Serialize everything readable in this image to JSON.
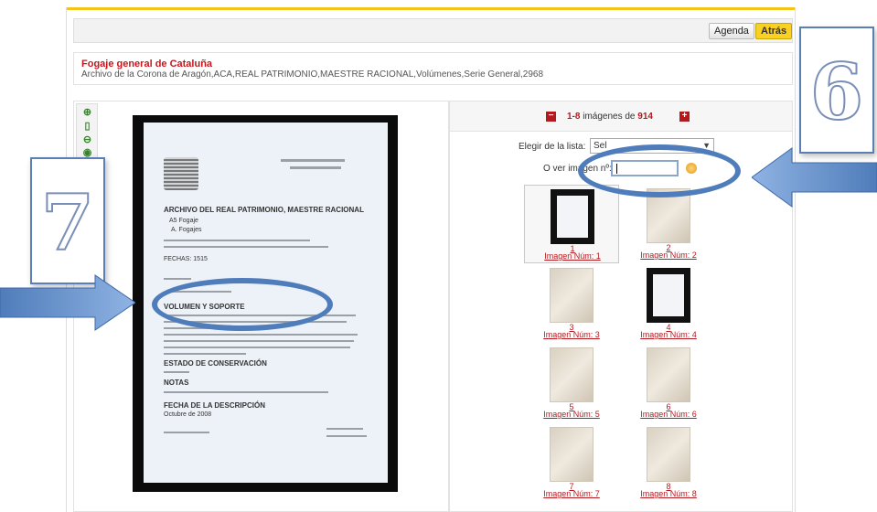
{
  "toolbar": {
    "agenda_label": "Agenda",
    "atras_label": "Atrás"
  },
  "record": {
    "title": "Fogaje general de Cataluña",
    "path": "Archivo de la Corona de Aragón,ACA,REAL PATRIMONIO,MAESTRE RACIONAL,Volúmenes,Serie General,2968"
  },
  "pager": {
    "range": "1-8",
    "mid": " imágenes de ",
    "total": "914"
  },
  "list": {
    "label": "Elegir de la lista:",
    "value": "Sel"
  },
  "goto": {
    "label": "O ver imagen nº:",
    "value": ""
  },
  "thumbnails": [
    {
      "num": "1",
      "caption": "Imagen Núm: 1"
    },
    {
      "num": "2",
      "caption": "Imagen Núm: 2"
    },
    {
      "num": "3",
      "caption": "Imagen Núm: 3"
    },
    {
      "num": "4",
      "caption": "Imagen Núm: 4"
    },
    {
      "num": "5",
      "caption": "Imagen Núm: 5"
    },
    {
      "num": "6",
      "caption": "Imagen Núm: 6"
    },
    {
      "num": "7",
      "caption": "Imagen Núm: 7"
    },
    {
      "num": "8",
      "caption": "Imagen Núm: 8"
    }
  ],
  "scan": {
    "heading": "ARCHIVO DEL REAL PATRIMONIO, MAESTRE RACIONAL",
    "line1": "A5 Fogaje",
    "line2": "A. Fogajes",
    "line3": "FECHAS:   1515",
    "line4": "VOLUMEN Y SOPORTE",
    "line5": "ESTADO DE CONSERVACIÓN",
    "line6": "NOTAS",
    "line7": "FECHA DE LA DESCRIPCIÓN",
    "line8": "Octubre de 2008"
  },
  "callouts": {
    "six": "6",
    "seven": "7"
  },
  "colors": {
    "accent": "#b4191f",
    "button": "#f9d024",
    "callout": "#4f7cba"
  }
}
